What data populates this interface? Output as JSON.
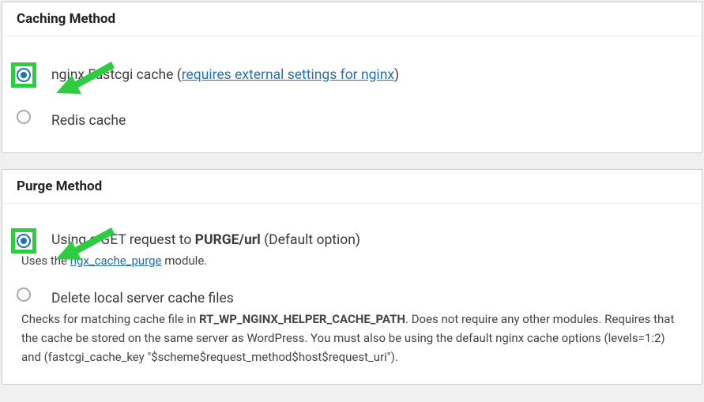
{
  "panels": {
    "caching": {
      "title": "Caching Method",
      "options": {
        "nginx": {
          "label_pre": "nginx Fastcgi cache (",
          "link": "requires external settings for nginx",
          "label_post": ")"
        },
        "redis": {
          "label": "Redis cache"
        }
      }
    },
    "purge": {
      "title": "Purge Method",
      "options": {
        "get": {
          "label_pre": "Using a GET request to ",
          "label_strong": "PURGE/url",
          "label_post": " (Default option)",
          "desc_pre": "Uses the ",
          "desc_link": "ngx_cache_purge",
          "desc_post": " module."
        },
        "delete": {
          "label": "Delete local server cache files",
          "desc_pre": "Checks for matching cache file in ",
          "desc_strong": "RT_WP_NGINX_HELPER_CACHE_PATH",
          "desc_post": ". Does not require any other modules. Requires that the cache be stored on the same server as WordPress. You must also be using the default nginx cache options (levels=1:2) and (fastcgi_cache_key \"$scheme$request_method$host$request_uri\")."
        }
      }
    }
  }
}
